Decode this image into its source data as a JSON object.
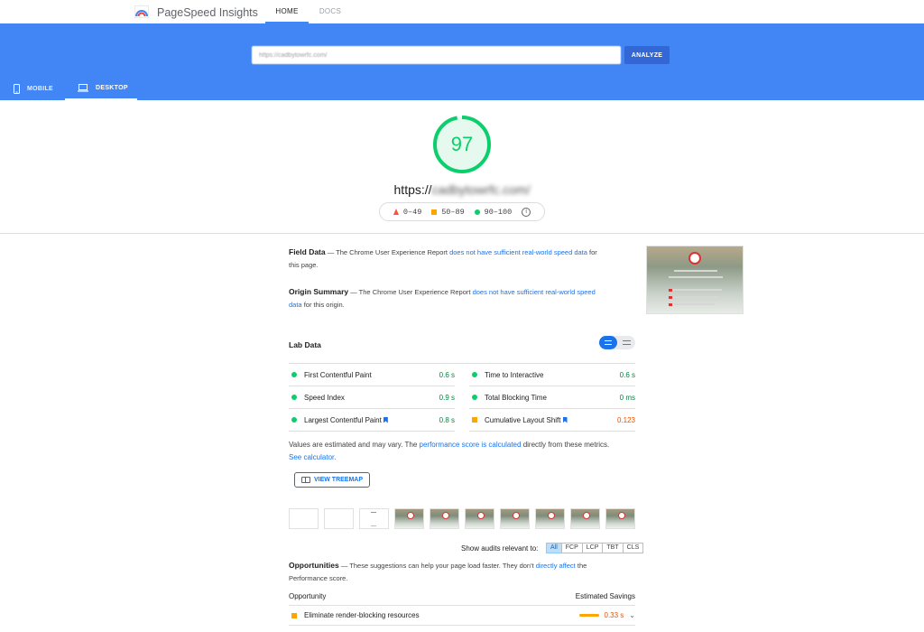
{
  "app": {
    "brand": "PageSpeed Insights",
    "nav": [
      "HOME",
      "DOCS"
    ],
    "active_nav": "HOME"
  },
  "search": {
    "url_value": "https://cadbytowrfc.com/",
    "analyze_label": "ANALYZE"
  },
  "device_tabs": {
    "mobile": "MOBILE",
    "desktop": "DESKTOP",
    "active": "DESKTOP"
  },
  "summary": {
    "score": "97",
    "score_value": 97,
    "tested_prefix": "https://",
    "tested_blurred": "cadbytowrfc.com/",
    "legend": [
      "0–49",
      "50–89",
      "90–100"
    ]
  },
  "field_data": {
    "title": "Field Data",
    "text_before": "— The Chrome User Experience Report ",
    "link": "does not have sufficient real-world speed data",
    "text_after": " for this page."
  },
  "origin_summary": {
    "title": "Origin Summary",
    "text_before": "— The Chrome User Experience Report ",
    "link": "does not have sufficient real-world speed data",
    "text_after": " for this origin."
  },
  "lab": {
    "title": "Lab Data",
    "metrics": [
      {
        "name": "First Contentful Paint",
        "value": "0.6 s",
        "status": "good"
      },
      {
        "name": "Time to Interactive",
        "value": "0.6 s",
        "status": "good"
      },
      {
        "name": "Speed Index",
        "value": "0.9 s",
        "status": "good"
      },
      {
        "name": "Total Blocking Time",
        "value": "0 ms",
        "status": "good"
      },
      {
        "name": "Largest Contentful Paint",
        "value": "0.8 s",
        "status": "good"
      },
      {
        "name": "Cumulative Layout Shift",
        "value": "0.123",
        "status": "average"
      }
    ],
    "note_before": "Values are estimated and may vary. The ",
    "note_link1": "performance score is calculated",
    "note_middle": " directly from these metrics. ",
    "note_link2": "See calculator.",
    "treemap_label": "VIEW TREEMAP"
  },
  "filter": {
    "label": "Show audits relevant to:",
    "chips": [
      "All",
      "FCP",
      "LCP",
      "TBT",
      "CLS"
    ],
    "active": "All"
  },
  "opportunities": {
    "title": "Opportunities",
    "text_before": "— These suggestions can help your page load faster. They don't ",
    "link": "directly affect",
    "text_after": " the Performance score.",
    "col_opportunity": "Opportunity",
    "col_savings": "Estimated Savings",
    "rows": [
      {
        "name": "Eliminate render-blocking resources",
        "savings": "0.33 s"
      }
    ]
  },
  "colors": {
    "header_blue": "#4285f4",
    "good": "#0cce6b",
    "average": "#ffa400",
    "poor": "#ff4e42",
    "link": "#1a73e8"
  }
}
